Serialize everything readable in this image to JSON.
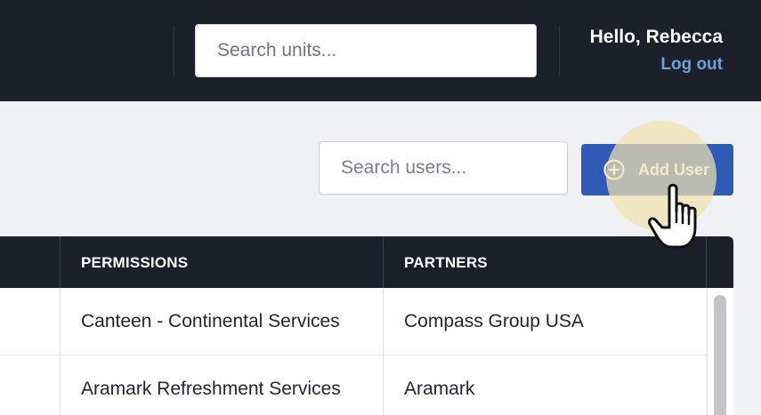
{
  "header": {
    "unit_search_placeholder": "Search units...",
    "greeting": "Hello, Rebecca",
    "logout_label": "Log out"
  },
  "toolbar": {
    "user_search_placeholder": "Search users...",
    "add_user_label": "Add User"
  },
  "table": {
    "columns": [
      "PERMISSIONS",
      "PARTNERS"
    ],
    "rows": [
      {
        "permissions": "Canteen - Continental Services",
        "partners": "Compass Group USA"
      },
      {
        "permissions": "Aramark Refreshment Services",
        "partners": "Aramark"
      }
    ]
  },
  "colors": {
    "header_bg": "#1b202b",
    "accent": "#2f5bb7",
    "link": "#6f9fdb"
  }
}
